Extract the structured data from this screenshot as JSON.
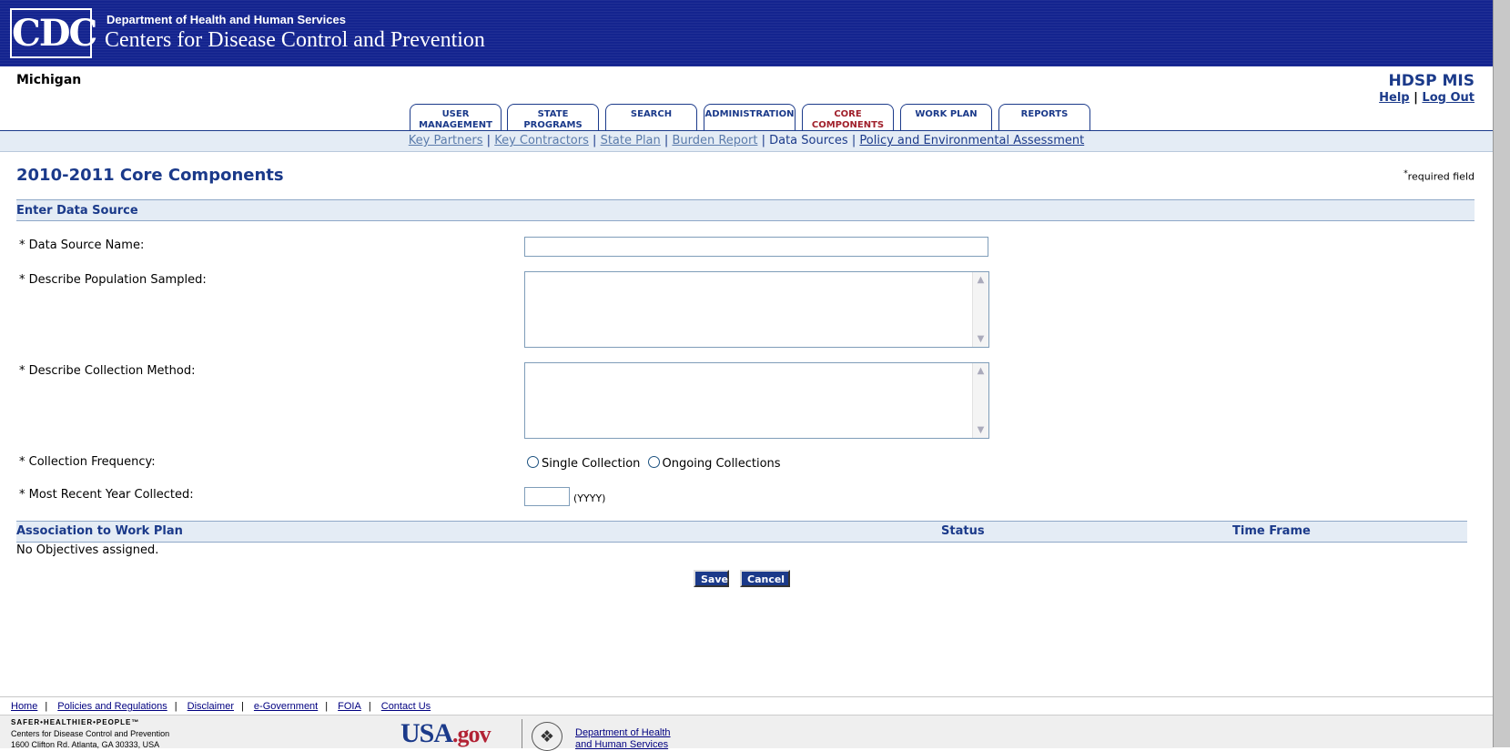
{
  "header": {
    "logo_text": "CDC",
    "department": "Department of Health and Human Services",
    "agency": "Centers for Disease Control and Prevention"
  },
  "state_name": "Michigan",
  "app_name": "HDSP MIS",
  "top_links": {
    "help": "Help",
    "separator": "|",
    "logout": "Log Out"
  },
  "tabs": [
    {
      "line1": "USER",
      "line2": "MANAGEMENT"
    },
    {
      "line1": "STATE",
      "line2": "PROGRAMS"
    },
    {
      "line1": "SEARCH",
      "line2": ""
    },
    {
      "line1": "ADMINISTRATION",
      "line2": ""
    },
    {
      "line1": "CORE",
      "line2": "COMPONENTS"
    },
    {
      "line1": "WORK PLAN",
      "line2": ""
    },
    {
      "line1": "REPORTS",
      "line2": ""
    }
  ],
  "subnav": {
    "key_partners": "Key Partners",
    "key_contractors": "Key Contractors",
    "state_plan": "State Plan",
    "burden_report": "Burden Report",
    "data_sources": "Data Sources",
    "policy": "Policy and Environmental Assessment",
    "separator": "|"
  },
  "page_title": "2010-2011 Core Components",
  "required_note": {
    "star": "*",
    "text": "required field"
  },
  "section_title": "Enter Data Source",
  "form": {
    "data_source_name_label": "* Data Source Name:",
    "data_source_name_value": "",
    "population_label": "* Describe Population Sampled:",
    "population_value": "",
    "method_label": "* Describe Collection Method:",
    "method_value": "",
    "frequency_label": "* Collection Frequency:",
    "frequency_options": [
      "Single Collection",
      "Ongoing Collections"
    ],
    "year_label": "* Most Recent Year Collected:",
    "year_value": "",
    "year_hint": "(YYYY)"
  },
  "association": {
    "col_plan": "Association to Work Plan",
    "col_status": "Status",
    "col_timeframe": "Time Frame",
    "empty_text": "No Objectives assigned."
  },
  "buttons": {
    "save": "Save",
    "cancel": "Cancel"
  },
  "footer": {
    "links": [
      "Home",
      "Policies and Regulations",
      "Disclaimer",
      "e-Government",
      "FOIA",
      "Contact Us"
    ],
    "tagline": "SAFER•HEALTHIER•PEOPLE™",
    "org": "Centers for Disease Control and Prevention",
    "address": "1600 Clifton Rd. Atlanta, GA 30333, USA",
    "usagov_usa": "USA",
    "usagov_gov": ".gov",
    "hhs_line1": "Department of Health",
    "hhs_line2": "and Human Services"
  }
}
